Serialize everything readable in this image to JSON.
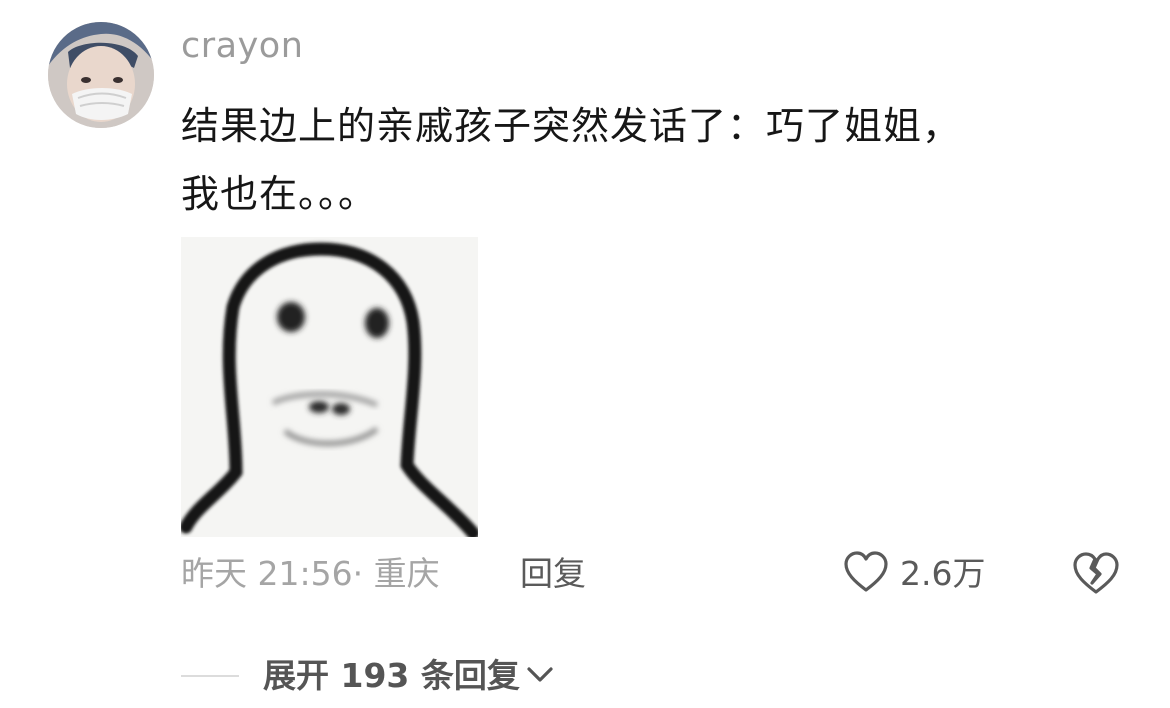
{
  "comment": {
    "username": "crayon",
    "text_line1": "结果边上的亲戚孩子突然发话了：巧了姐姐，",
    "text_line2": "我也在。。。",
    "meta": "昨天 21:56· 重庆",
    "reply_label": "回复",
    "like_count": "2.6万",
    "expand_label": "展开 193 条回复",
    "icons": {
      "like": "heart-outline-icon",
      "dislike": "broken-heart-icon",
      "expand": "chevron-down-icon"
    },
    "colors": {
      "text": "#161616",
      "muted": "#a5a5a5",
      "action": "#5a5a5a"
    }
  }
}
